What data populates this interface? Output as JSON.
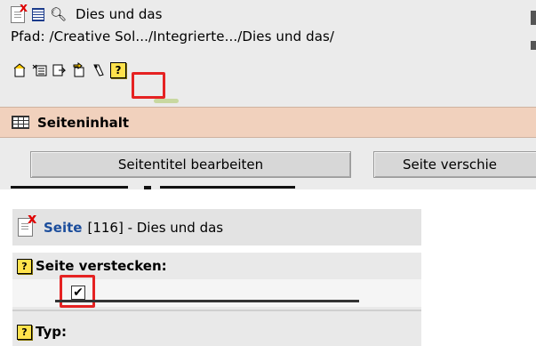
{
  "header": {
    "title": "Dies und das",
    "path": "Pfad: /Creative Sol.../Integrierte.../Dies und das/"
  },
  "toolbar": {
    "icons": [
      "page-new-icon",
      "record-list-icon",
      "copy-icon",
      "move-icon",
      "wizard-icon",
      "help-icon"
    ],
    "help_label": "?"
  },
  "section": {
    "title": "Seiteninhalt"
  },
  "buttons": {
    "edit_title": "Seitentitel bearbeiten",
    "move_page": "Seite verschie"
  },
  "record": {
    "table": "Seite",
    "id_and_title": "[116] - Dies und das"
  },
  "fields": {
    "hide_page": {
      "label": "Seite verstecken:",
      "checked": true,
      "check_mark": "✔"
    },
    "type": {
      "label": "Typ:"
    }
  },
  "colors": {
    "section_bg": "#f1d1bd",
    "highlight": "#e52222",
    "link": "#1b4d9c",
    "help_yellow": "#ffe24c"
  }
}
